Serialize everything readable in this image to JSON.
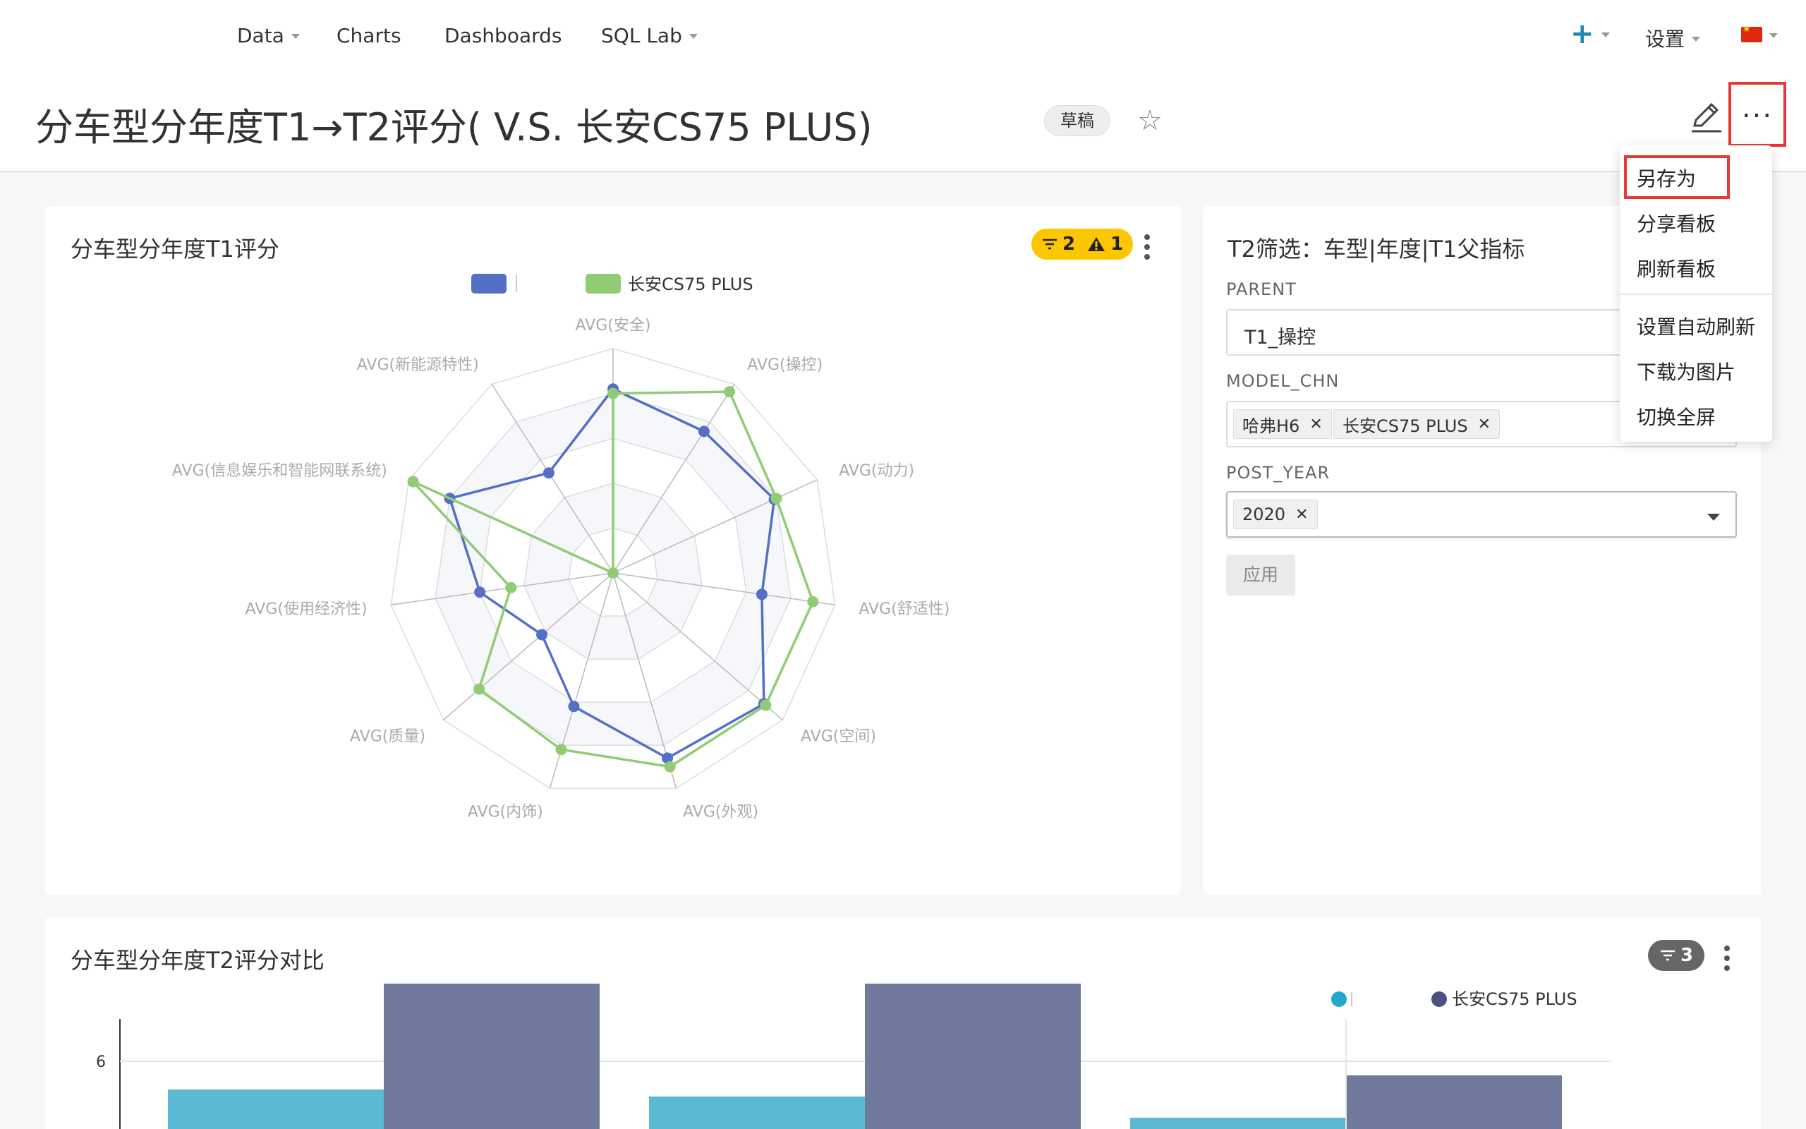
{
  "nav": {
    "data": "Data",
    "charts": "Charts",
    "dashboards": "Dashboards",
    "sql_lab": "SQL Lab",
    "plus": "+",
    "settings": "设置"
  },
  "dashboard": {
    "title": "分车型分年度T1→T2评分(                V.S. 长安CS75 PLUS)",
    "status": "草稿"
  },
  "menu": {
    "items": [
      "另存为",
      "分享看板",
      "刷新看板",
      "设置自动刷新",
      "下载为图片",
      "切换全屏"
    ]
  },
  "radar_card": {
    "title": "分车型分年度T1评分",
    "filter_count": "2",
    "warning_count": "1"
  },
  "filter_card": {
    "title": "T2筛选：车型|年度|T1父指标",
    "parent_label": "PARENT",
    "parent_value": "T1_操控",
    "model_label": "MODEL_CHN",
    "model_tags": [
      "哈弗H6",
      "长安CS75 PLUS"
    ],
    "year_label": "POST_YEAR",
    "year_tags": [
      "2020"
    ],
    "apply_label": "应用"
  },
  "bar_card": {
    "title": "分车型分年度T2评分对比",
    "filter_count": "3"
  },
  "colors": {
    "series_a": "#5470c6",
    "series_b": "#91cc75",
    "bar_a": "#5bb9d1",
    "bar_b": "#717a9c",
    "warn": "#fcc700",
    "highlight": "#e53935"
  },
  "chart_data": [
    {
      "type": "radar",
      "title": "分车型分年度T1评分",
      "legend_position": "top",
      "indicators": [
        "AVG(安全)",
        "AVG(操控)",
        "AVG(动力)",
        "AVG(舒适性)",
        "AVG(空间)",
        "AVG(外观)",
        "AVG(内饰)",
        "AVG(质量)",
        "AVG(使用经济性)",
        "AVG(信息娱乐和智能网联系统)",
        "AVG(新能源特性)"
      ],
      "max": 1.0,
      "series": [
        {
          "name": "",
          "values": [
            0.82,
            0.75,
            0.79,
            0.67,
            0.89,
            0.86,
            0.62,
            0.42,
            0.6,
            0.8,
            0.53
          ]
        },
        {
          "name": "长安CS75 PLUS",
          "values": [
            0.8,
            0.96,
            0.8,
            0.9,
            0.9,
            0.9,
            0.82,
            0.79,
            0.46,
            0.98,
            0.0
          ]
        }
      ]
    },
    {
      "type": "bar",
      "title": "分车型分年度T2评分对比",
      "legend_position": "top-right",
      "y_ticks": [
        6
      ],
      "series": [
        {
          "name": "",
          "values": [
            5.8,
            5.75,
            5.6
          ]
        },
        {
          "name": "长安CS75 PLUS",
          "values": [
            6.55,
            6.55,
            5.9
          ]
        }
      ]
    }
  ]
}
